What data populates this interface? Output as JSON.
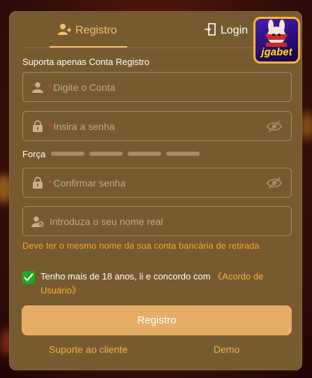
{
  "tabs": {
    "registro": "Registro",
    "login": "Login"
  },
  "logo": {
    "text": "jgabet"
  },
  "form": {
    "section_title": "Suporta apenas Conta Registro",
    "account": {
      "required_mark": "*",
      "placeholder": "Digite o Conta"
    },
    "password": {
      "required_mark": "*",
      "placeholder": "Insira a senha"
    },
    "strength_label": "Força",
    "confirm": {
      "required_mark": "*",
      "placeholder": "Confirmar senha"
    },
    "realname": {
      "placeholder": "Introduza o seu nome real"
    },
    "realname_hint": "Deve ter o mesmo nome da sua conta bancária de retirada",
    "agree_text": "Tenho mais de 18 anos, li e concordo com",
    "agree_link": "《Acordo de Usuário》",
    "agree_checked": true,
    "submit_label": "Registro"
  },
  "footer": {
    "support": "Suporte ao cliente",
    "demo": "Demo"
  },
  "colors": {
    "panel": "#765a30",
    "accent": "#f1c06b",
    "link": "#f3b13e",
    "submit": "#e6ad66",
    "required": "#e34a3b",
    "checkbox": "#26a626"
  }
}
